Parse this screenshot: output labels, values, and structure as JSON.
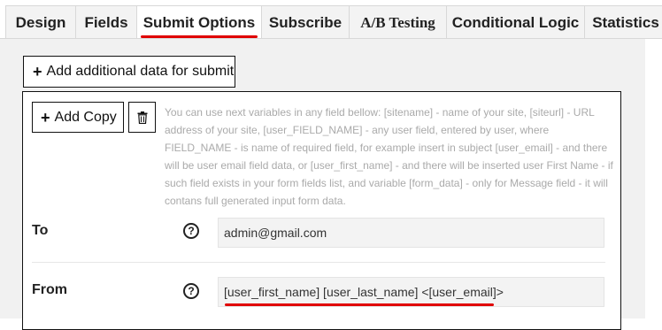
{
  "tabs": [
    {
      "label": "Design",
      "active": false
    },
    {
      "label": "Fields",
      "active": false
    },
    {
      "label": "Submit Options",
      "active": true
    },
    {
      "label": "Subscribe",
      "active": false
    },
    {
      "label": "A/B Testing",
      "active": false
    },
    {
      "label": "Conditional Logic",
      "active": false
    },
    {
      "label": "Statistics",
      "active": false
    }
  ],
  "actions": {
    "add_data_label": "Add additional data for submit",
    "add_copy_label": "Add Copy"
  },
  "help_text": "You can use next variables in any field bellow: [sitename] - name of your site, [siteurl] - URL address of your site, [user_FIELD_NAME] - any user field, entered by user, where FIELD_NAME - is name of required field, for example insert in subject [user_email] - and there will be user email field data, or [user_first_name] - and there will be inserted user First Name - if such field exists in your form fields list, and variable [form_data] - only for Message field - it will contans full generated input form data.",
  "fields": {
    "to": {
      "label": "To",
      "value": "admin@gmail.com"
    },
    "from": {
      "label": "From",
      "value": "[user_first_name] [user_last_name] <[user_email]>"
    }
  },
  "icons": {
    "add": "plus-icon",
    "delete": "trash-icon",
    "help": "question-circle-icon"
  },
  "colors": {
    "accent": "#e00000"
  }
}
